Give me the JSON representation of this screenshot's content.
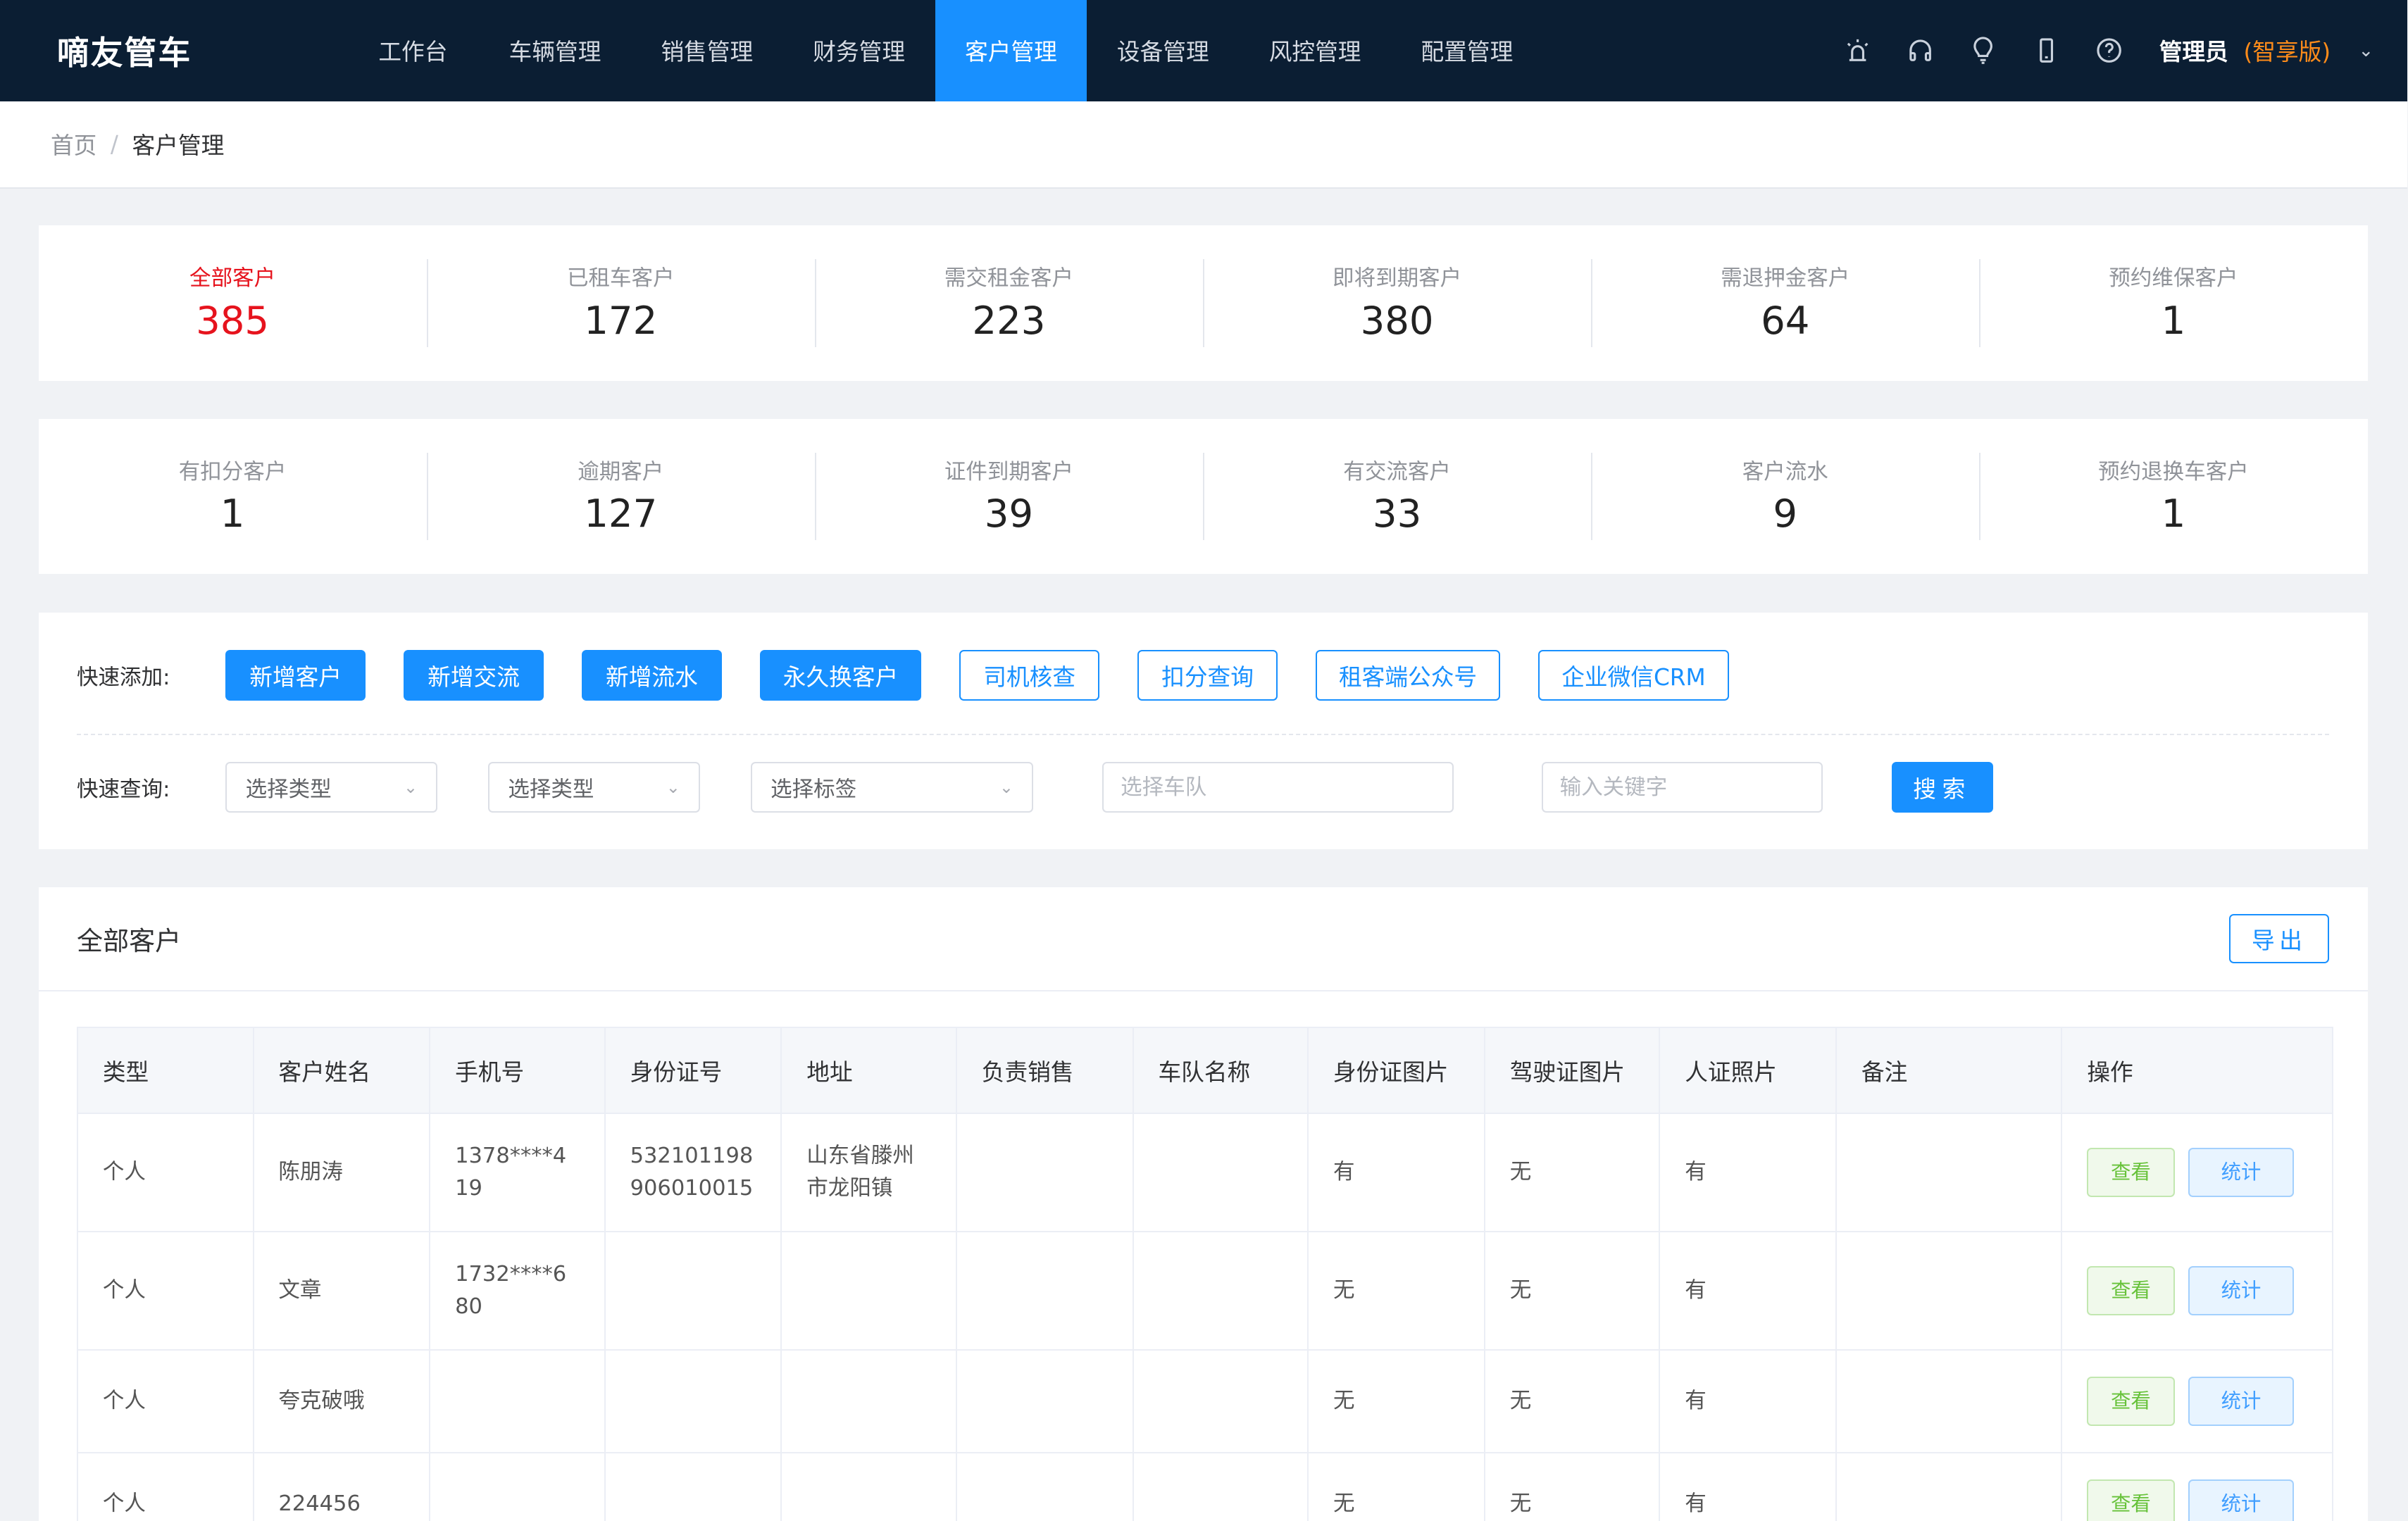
{
  "header": {
    "brand": "嘀友管车",
    "nav": [
      "工作台",
      "车辆管理",
      "销售管理",
      "财务管理",
      "客户管理",
      "设备管理",
      "风控管理",
      "配置管理"
    ],
    "active_nav": "客户管理",
    "user": "管理员",
    "edition": "(智享版)"
  },
  "breadcrumb": {
    "home": "首页",
    "sep": "/",
    "current": "客户管理"
  },
  "stats_row1": [
    {
      "label": "全部客户",
      "value": "385"
    },
    {
      "label": "已租车客户",
      "value": "172"
    },
    {
      "label": "需交租金客户",
      "value": "223"
    },
    {
      "label": "即将到期客户",
      "value": "380"
    },
    {
      "label": "需退押金客户",
      "value": "64"
    },
    {
      "label": "预约维保客户",
      "value": "1"
    }
  ],
  "stats_row2": [
    {
      "label": "有扣分客户",
      "value": "1"
    },
    {
      "label": "逾期客户",
      "value": "127"
    },
    {
      "label": "证件到期客户",
      "value": "39"
    },
    {
      "label": "有交流客户",
      "value": "33"
    },
    {
      "label": "客户流水",
      "value": "9"
    },
    {
      "label": "预约退换车客户",
      "value": "1"
    }
  ],
  "quick_add": {
    "label": "快速添加:",
    "solid_buttons": [
      "新增客户",
      "新增交流",
      "新增流水",
      "永久换客户"
    ],
    "ghost_buttons": [
      "司机核查",
      "扣分查询",
      "租客端公众号",
      "企业微信CRM"
    ]
  },
  "quick_query": {
    "label": "快速查询:",
    "select1": "选择类型",
    "select2": "选择类型",
    "select3": "选择标签",
    "fleet_placeholder": "选择车队",
    "keyword_placeholder": "输入关键字",
    "search": "搜索"
  },
  "table": {
    "title": "全部客户",
    "export": "导出",
    "columns": [
      "类型",
      "客户姓名",
      "手机号",
      "身份证号",
      "地址",
      "负责销售",
      "车队名称",
      "身份证图片",
      "驾驶证图片",
      "人证照片",
      "备注",
      "操作"
    ],
    "view_label": "查看",
    "stat_label": "统计",
    "rows": [
      {
        "type": "个人",
        "name": "陈朋涛",
        "phone": "1378****419",
        "id_no": "532101198906010015",
        "address": "山东省滕州市龙阳镇",
        "sales": "",
        "fleet": "",
        "id_img": "有",
        "license_img": "无",
        "photo": "有",
        "note": ""
      },
      {
        "type": "个人",
        "name": "文章",
        "phone": "1732****680",
        "id_no": "",
        "address": "",
        "sales": "",
        "fleet": "",
        "id_img": "无",
        "license_img": "无",
        "photo": "有",
        "note": ""
      },
      {
        "type": "个人",
        "name": "夸克破哦",
        "phone": "",
        "id_no": "",
        "address": "",
        "sales": "",
        "fleet": "",
        "id_img": "无",
        "license_img": "无",
        "photo": "有",
        "note": ""
      },
      {
        "type": "个人",
        "name": "224456",
        "phone": "",
        "id_no": "",
        "address": "",
        "sales": "",
        "fleet": "",
        "id_img": "无",
        "license_img": "无",
        "photo": "有",
        "note": ""
      }
    ]
  },
  "icons": [
    "alarm-icon",
    "headset-icon",
    "bulb-icon",
    "phone-icon",
    "help-icon",
    "chevron-down-icon"
  ],
  "colors": {
    "header_bg": "#0b1e33",
    "accent": "#1890ff",
    "highlight_red": "#e6131d",
    "edition_orange": "#ff8c1a"
  }
}
